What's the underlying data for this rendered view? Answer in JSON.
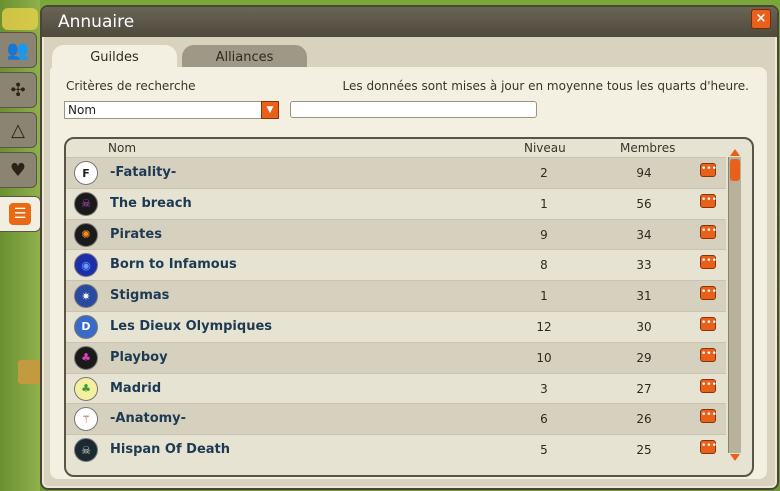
{
  "window": {
    "title": "Annuaire",
    "close_icon": "close-icon"
  },
  "tabs": [
    {
      "label": "Guildes",
      "active": true
    },
    {
      "label": "Alliances",
      "active": false
    }
  ],
  "side_tabs": [
    {
      "icon": "people-icon",
      "glyph": "👥"
    },
    {
      "icon": "knot-icon",
      "glyph": "✣"
    },
    {
      "icon": "triangle-knot-icon",
      "glyph": "△"
    },
    {
      "icon": "heart-icon",
      "glyph": "♥"
    },
    {
      "icon": "directory-icon",
      "glyph": "☰",
      "active": true
    }
  ],
  "search": {
    "criteria_label": "Critères de recherche",
    "criteria_value": "Nom",
    "update_note": "Les données sont mises à jour en moyenne tous les quarts d'heure.",
    "query_value": ""
  },
  "table": {
    "columns": {
      "name": "Nom",
      "level": "Niveau",
      "members": "Membres"
    },
    "rows": [
      {
        "name": "-Fatality-",
        "level": "2",
        "members": "94",
        "emblem_bg": "#ffffff",
        "emblem_fg": "#222222",
        "emblem_glyph": "F"
      },
      {
        "name": "The breach",
        "level": "1",
        "members": "56",
        "emblem_bg": "#1a1a1a",
        "emblem_fg": "#c04bd0",
        "emblem_glyph": "☠"
      },
      {
        "name": "Pirates",
        "level": "9",
        "members": "34",
        "emblem_bg": "#1a1a1a",
        "emblem_fg": "#f09020",
        "emblem_glyph": "✺"
      },
      {
        "name": "Born to Infamous",
        "level": "8",
        "members": "33",
        "emblem_bg": "#1c2fa8",
        "emblem_fg": "#6a9aff",
        "emblem_glyph": "◉"
      },
      {
        "name": "Stigmas",
        "level": "1",
        "members": "31",
        "emblem_bg": "#2a4aa0",
        "emblem_fg": "#ffffff",
        "emblem_glyph": "✷"
      },
      {
        "name": "Les Dieux Olympiques",
        "level": "12",
        "members": "30",
        "emblem_bg": "#3a6ac8",
        "emblem_fg": "#ffffff",
        "emblem_glyph": "D"
      },
      {
        "name": "Playboy",
        "level": "10",
        "members": "29",
        "emblem_bg": "#1a1a1a",
        "emblem_fg": "#e040c0",
        "emblem_glyph": "♣"
      },
      {
        "name": "Madrid",
        "level": "3",
        "members": "27",
        "emblem_bg": "#f4f0a0",
        "emblem_fg": "#3a9a30",
        "emblem_glyph": "♣"
      },
      {
        "name": "-Anatomy-",
        "level": "6",
        "members": "26",
        "emblem_bg": "#ffffff",
        "emblem_fg": "#b02020",
        "emblem_glyph": "⚚"
      },
      {
        "name": "Hispan Of Death",
        "level": "5",
        "members": "25",
        "emblem_bg": "#1a2a30",
        "emblem_fg": "#dddddd",
        "emblem_glyph": "☠"
      }
    ]
  },
  "colors": {
    "accent": "#e8601a",
    "name_text": "#1d3a52",
    "panel": "#f3f0e2"
  }
}
